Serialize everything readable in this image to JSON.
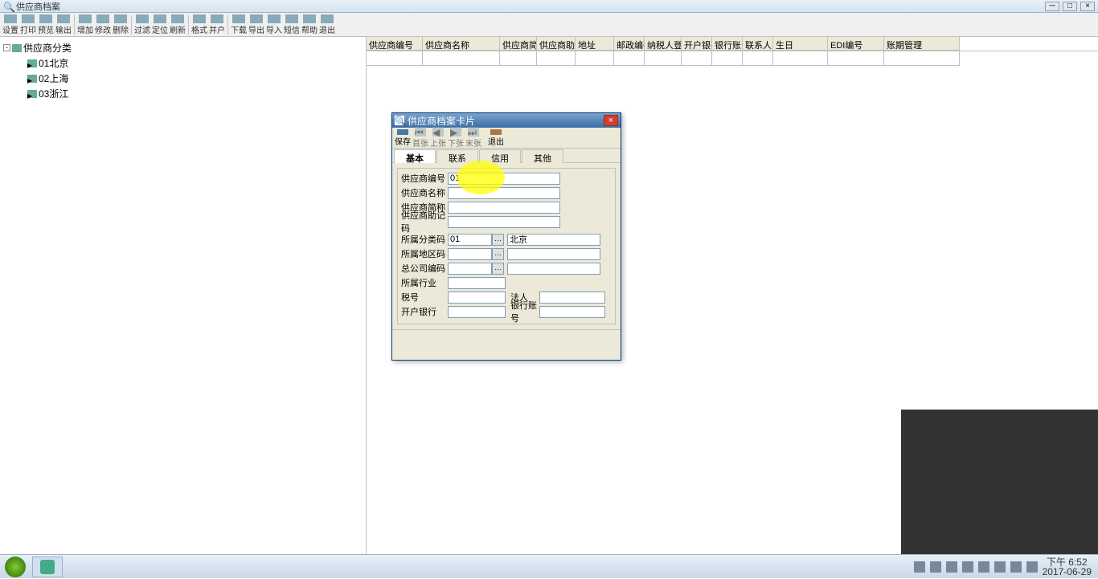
{
  "window": {
    "title": "供应商档案"
  },
  "toolbar": [
    {
      "label": "设置"
    },
    {
      "label": "打印"
    },
    {
      "label": "预览"
    },
    {
      "label": "输出"
    },
    {
      "label": "增加"
    },
    {
      "label": "修改"
    },
    {
      "label": "删除"
    },
    {
      "label": "过滤"
    },
    {
      "label": "定位"
    },
    {
      "label": "刷新"
    },
    {
      "label": "格式"
    },
    {
      "label": "并户"
    },
    {
      "label": "下载"
    },
    {
      "label": "导出"
    },
    {
      "label": "导入"
    },
    {
      "label": "短信"
    },
    {
      "label": "帮助"
    },
    {
      "label": "退出"
    }
  ],
  "tree": {
    "root": "供应商分类",
    "children": [
      {
        "label": "01北京"
      },
      {
        "label": "02上海"
      },
      {
        "label": "03浙江"
      }
    ]
  },
  "grid": {
    "columns": [
      "供应商编号",
      "供应商名称",
      "供应商简称",
      "供应商助记",
      "地址",
      "邮政编码",
      "纳税人登记",
      "开户银行",
      "银行账号",
      "联系人",
      "生日",
      "EDI编号",
      "账期管理"
    ],
    "widths": [
      70,
      96,
      46,
      48,
      48,
      38,
      46,
      38,
      38,
      38,
      68,
      70,
      94
    ]
  },
  "dialog": {
    "title": "供应商档案卡片",
    "toolbar": [
      {
        "label": "保存",
        "enabled": true
      },
      {
        "label": "首张",
        "enabled": false
      },
      {
        "label": "上张",
        "enabled": false
      },
      {
        "label": "下张",
        "enabled": false
      },
      {
        "label": "末张",
        "enabled": false
      },
      {
        "label": "退出",
        "enabled": true
      }
    ],
    "tabs": [
      "基本",
      "联系",
      "信用",
      "其他"
    ],
    "active_tab": 0,
    "form": {
      "supplier_code_label": "供应商编号",
      "supplier_code_value": "01",
      "supplier_name_label": "供应商名称",
      "supplier_name_value": "",
      "supplier_short_label": "供应商简称",
      "supplier_short_value": "",
      "supplier_mnemonic_label": "供应商助记码",
      "supplier_mnemonic_value": "",
      "category_code_label": "所属分类码",
      "category_code_value": "01",
      "category_name_value": "北京",
      "region_code_label": "所属地区码",
      "region_code_value": "",
      "region_name_value": "",
      "parent_code_label": "总公司编码",
      "parent_code_value": "",
      "parent_name_value": "",
      "industry_label": "所属行业",
      "industry_value": "",
      "tax_label": "税号",
      "tax_value": "",
      "legal_label": "法人",
      "legal_value": "",
      "bank_label": "开户银行",
      "bank_value": "",
      "account_label": "银行账号",
      "account_value": ""
    }
  },
  "taskbar": {
    "time": "下午 6:52",
    "date": "2017-06-29"
  }
}
